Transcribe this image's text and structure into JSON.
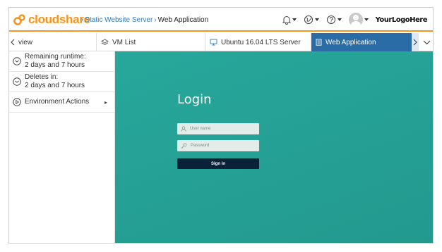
{
  "brand": {
    "name": "cloudshare",
    "color": "#f7941d"
  },
  "breadcrumb": {
    "parent": "Static Website Server",
    "current": "Web Application"
  },
  "header": {
    "logo_placeholder": "YourLogoHere"
  },
  "tabs": [
    {
      "label": "view",
      "icon": "chevron-left-icon"
    },
    {
      "label": "VM List",
      "icon": "layers-icon"
    },
    {
      "label": "Ubuntu 16.04 LTS Server",
      "icon": "monitor-icon"
    },
    {
      "label": "Web Application",
      "icon": "document-icon",
      "active": true
    }
  ],
  "sidebar": {
    "items": [
      {
        "line1": "Remaining runtime:",
        "line2": "2 days and 7 hours",
        "icon": "clock-icon"
      },
      {
        "line1": "Deletes in:",
        "line2": "2 days and 7 hours",
        "icon": "clock-icon"
      },
      {
        "line1": "Environment Actions",
        "icon": "play-icon"
      }
    ]
  },
  "login": {
    "title": "Login",
    "username_placeholder": "User name",
    "password_placeholder": "Password",
    "signin_label": "Sign in"
  },
  "colors": {
    "accent": "#2a6da6",
    "teal": "#27a79b",
    "signin": "#0b2138"
  }
}
